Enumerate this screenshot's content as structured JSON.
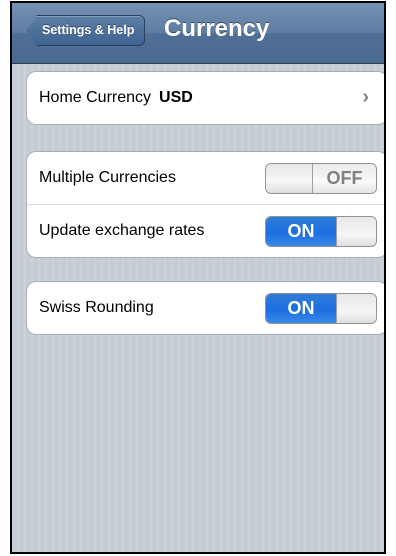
{
  "navbar": {
    "back_label": "Settings & Help",
    "title": "Currency"
  },
  "home_currency": {
    "label": "Home Currency",
    "value": "USD",
    "chevron": "›"
  },
  "multiple_currencies": {
    "label": "Multiple Currencies",
    "state": "OFF"
  },
  "update_rates": {
    "label": "Update exchange rates",
    "state": "ON"
  },
  "swiss_rounding": {
    "label": "Swiss Rounding",
    "state": "ON"
  },
  "colors": {
    "navbar": "#5e7da3",
    "switch_on": "#1d6ee0",
    "background": "#c5ccd4"
  }
}
